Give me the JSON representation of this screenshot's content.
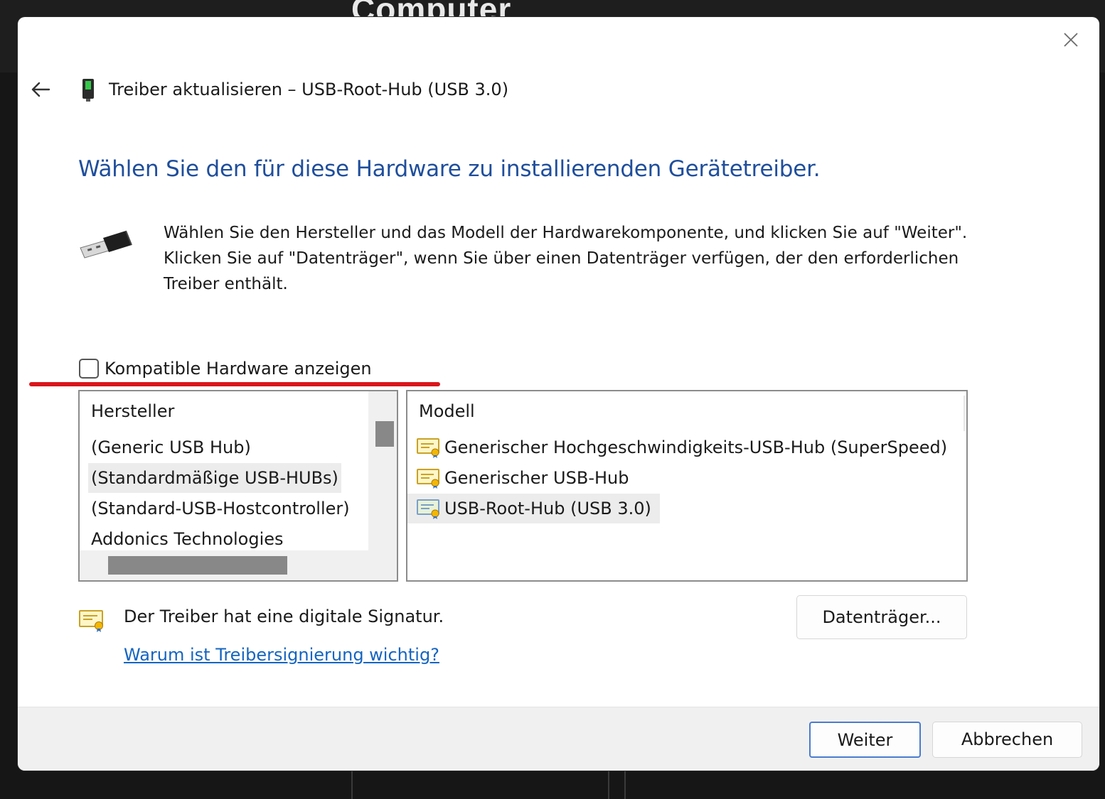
{
  "background": {
    "logo_text": "Computer"
  },
  "dialog": {
    "title": "Treiber aktualisieren – USB-Root-Hub (USB 3.0)",
    "heading": "Wählen Sie den für diese Hardware zu installierenden Gerätetreiber.",
    "instructions": "Wählen Sie den Hersteller und das Modell der Hardwarekomponente, und klicken Sie auf \"Weiter\". Klicken Sie auf \"Datenträger\", wenn Sie über einen Datenträger verfügen, der den erforderlichen Treiber enthält.",
    "compatible_checkbox": {
      "label": "Kompatible Hardware anzeigen",
      "checked": false
    },
    "manufacturer_list": {
      "header": "Hersteller",
      "items": [
        "(Generic USB Hub)",
        "(Standardmäßige USB-HUBs)",
        "(Standard-USB-Hostcontroller)",
        "Addonics Technologies"
      ],
      "selected_index": 1
    },
    "model_list": {
      "header": "Modell",
      "items": [
        "Generischer Hochgeschwindigkeits-USB-Hub (SuperSpeed)",
        "Generischer USB-Hub",
        "USB-Root-Hub (USB 3.0)"
      ],
      "selected_index": 2
    },
    "signature_text": "Der Treiber hat eine digitale Signatur.",
    "signature_link": "Warum ist Treibersignierung wichtig?",
    "disk_button": "Datenträger...",
    "next_button": "Weiter",
    "cancel_button": "Abbrechen",
    "colors": {
      "heading": "#1f4e9c",
      "link": "#1565c0",
      "highlight_underline": "#d9161b",
      "next_border": "#4a7bd0"
    }
  }
}
